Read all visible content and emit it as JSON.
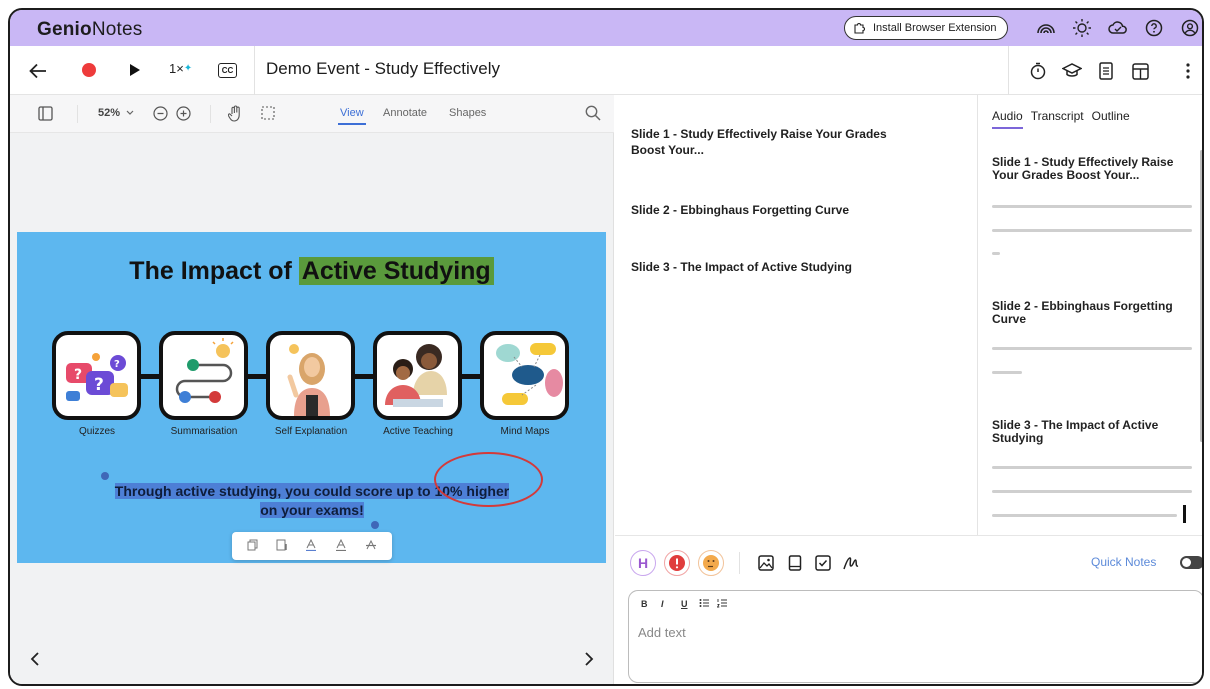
{
  "app": {
    "brand_bold": "Genio",
    "brand_light": "Notes",
    "install_extension_label": "Install Browser Extension"
  },
  "toolbar": {
    "speed_label": "1×",
    "speed_badge": "✦",
    "cc_label": "CC",
    "event_title": "Demo Event - Study Effectively"
  },
  "viewer": {
    "zoom_label": "52%",
    "tabs": [
      "View",
      "Annotate",
      "Shapes"
    ],
    "active_tab": "View"
  },
  "slide": {
    "title_prefix": "The Impact of ",
    "title_highlight": "Active Studying",
    "cards": [
      "Quizzes",
      "Summarisation",
      "Self Explanation",
      "Active Teaching",
      "Mind Maps"
    ],
    "caption_line1": "Through active studying, you could score up to 10% higher",
    "caption_line2": "on your exams!"
  },
  "slide_list": [
    "Slide 1 - Study Effectively Raise Your Grades Boost Your...",
    "Slide 2 - Ebbinghaus Forgetting Curve",
    "Slide 3 - The Impact of Active Studying"
  ],
  "right_panel": {
    "tabs": [
      "Audio",
      "Transcript",
      "Outline"
    ],
    "active_tab": "Audio",
    "sections": [
      "Slide 1 - Study Effectively Raise Your Grades Boost Your...",
      "Slide 2 - Ebbinghaus Forgetting Curve",
      "Slide 3 - The Impact of Active Studying"
    ]
  },
  "notes": {
    "buttons": [
      "H",
      "!",
      ""
    ],
    "quick_notes_label": "Quick Notes",
    "format_buttons": [
      "B",
      "I",
      "U"
    ],
    "placeholder": "Add text"
  },
  "colors": {
    "topbar": "#c9b7f5",
    "record": "#ee3b3b",
    "slide_bg": "#5db7ef",
    "highlight": "#5a9a3c",
    "annotation_circle": "#d33a3a"
  }
}
